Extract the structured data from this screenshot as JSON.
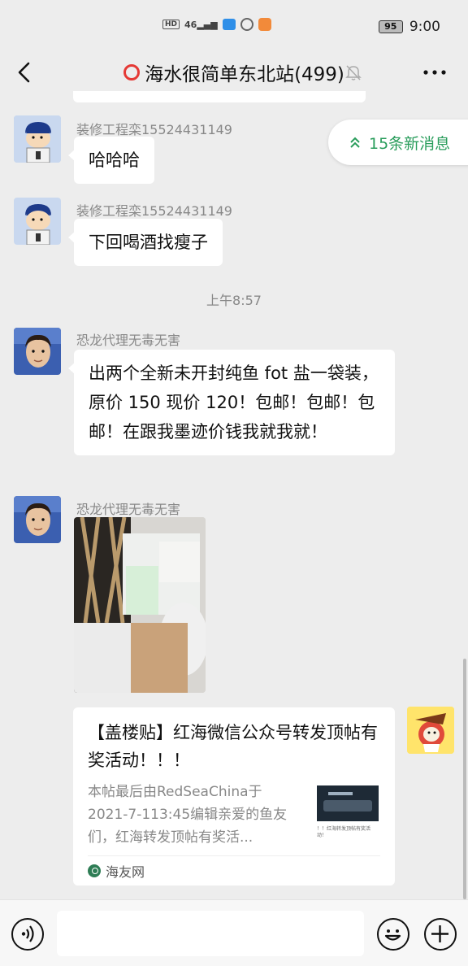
{
  "status_bar": {
    "time": "9:00",
    "battery": "95",
    "hd": "HD",
    "signal": "46"
  },
  "header": {
    "title": "海水很简单东北站(499)",
    "back_icon": "chevron-left-icon",
    "mute_icon": "bell-off-icon",
    "more_icon": "more-horizontal-icon"
  },
  "new_messages": {
    "label": "15条新消息"
  },
  "messages": [
    {
      "sender": "装修工程栾15524431149",
      "text": "哈哈哈"
    },
    {
      "sender": "装修工程栾15524431149",
      "text": "下回喝酒找瘦子"
    },
    {
      "sender": "恐龙代理无毒无害",
      "text": "出两个全新未开封纯鱼 fot 盐一袋装，原价 150 现价 120！包邮！包邮！包邮！在跟我墨迹价钱我就我就！"
    },
    {
      "sender": "恐龙代理无毒无害",
      "image": "photo of salt boxes and folding chairs"
    }
  ],
  "time_divider": "上午8:57",
  "link_card": {
    "title": "【盖楼贴】红海微信公众号转发顶帖有奖活动！！！",
    "description": "本帖最后由RedSeaChina于 2021-7-113:45编辑亲爱的鱼友们，红海转发顶帖有奖活...",
    "source": "海友网",
    "thumb_caption": "！！红海转发顶帖有奖活动！"
  },
  "input_bar": {
    "placeholder": "",
    "voice_icon": "voice-icon",
    "emoji_icon": "emoji-icon",
    "plus_icon": "plus-icon"
  },
  "colors": {
    "background": "#ededed",
    "bubble": "#ffffff",
    "accent_green": "#2a9d5c",
    "title_ring": "#e53935"
  }
}
